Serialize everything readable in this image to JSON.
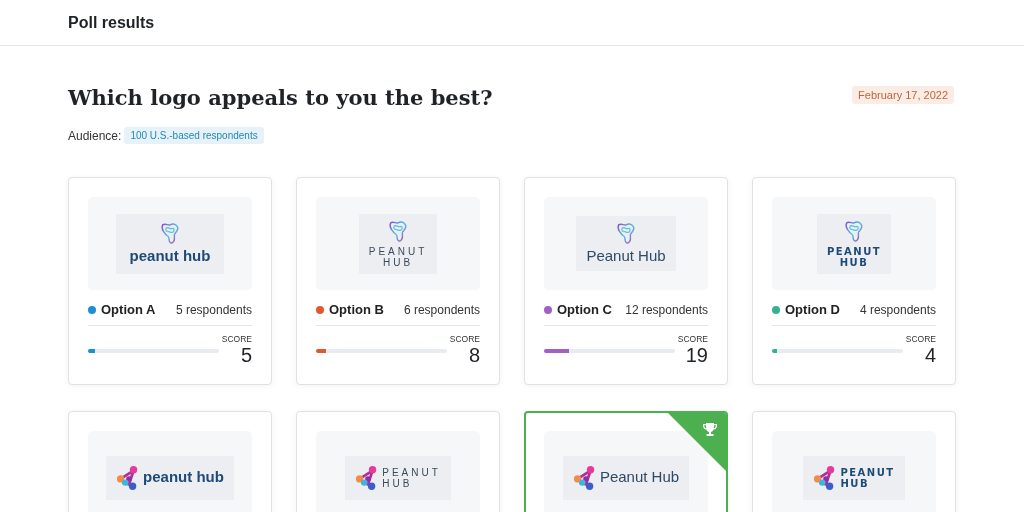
{
  "header": {
    "title": "Poll results"
  },
  "poll": {
    "question": "Which logo appeals to you the best?",
    "date": "February 17, 2022",
    "audience_label": "Audience:",
    "audience": "100 U.S.-based respondents"
  },
  "options": [
    {
      "logo": {
        "kind": "outline",
        "wordmark": {
          "kind": "rounded",
          "lines": [
            "peanut hub"
          ]
        }
      },
      "winner": false,
      "name": "Option A",
      "color": "#1a8fd6",
      "respondents": "5 respondents",
      "score_label": "SCORE",
      "score": "5",
      "level": 0.05
    },
    {
      "logo": {
        "kind": "outline",
        "wordmark": {
          "kind": "spaced",
          "lines": [
            "PEANUT",
            "HUB"
          ]
        }
      },
      "winner": false,
      "name": "Option B",
      "color": "#e0582b",
      "respondents": "6 respondents",
      "score_label": "SCORE",
      "score": "8",
      "level": 0.08
    },
    {
      "logo": {
        "kind": "outline",
        "wordmark": {
          "kind": "light",
          "lines": [
            "Peanut Hub"
          ]
        }
      },
      "winner": false,
      "name": "Option C",
      "color": "#a15fc7",
      "respondents": "12 respondents",
      "score_label": "SCORE",
      "score": "19",
      "level": 0.19
    },
    {
      "logo": {
        "kind": "outline",
        "wordmark": {
          "kind": "geometric",
          "lines": [
            "PEANUT",
            "HUB"
          ]
        }
      },
      "winner": false,
      "name": "Option D",
      "color": "#35b095",
      "respondents": "4 respondents",
      "score_label": "SCORE",
      "score": "4",
      "level": 0.04
    },
    {
      "logo": {
        "kind": "molecule",
        "wordmark": {
          "kind": "rounded",
          "lines": [
            "peanut hub"
          ]
        }
      },
      "winner": false
    },
    {
      "logo": {
        "kind": "molecule",
        "wordmark": {
          "kind": "spaced",
          "lines": [
            "PEANUT",
            "HUB"
          ]
        }
      },
      "winner": false
    },
    {
      "logo": {
        "kind": "molecule",
        "wordmark": {
          "kind": "light",
          "lines": [
            "Peanut Hub"
          ]
        }
      },
      "winner": true
    },
    {
      "logo": {
        "kind": "molecule",
        "wordmark": {
          "kind": "geometric",
          "lines": [
            "PEANUT",
            "HUB"
          ]
        }
      },
      "winner": false
    }
  ]
}
